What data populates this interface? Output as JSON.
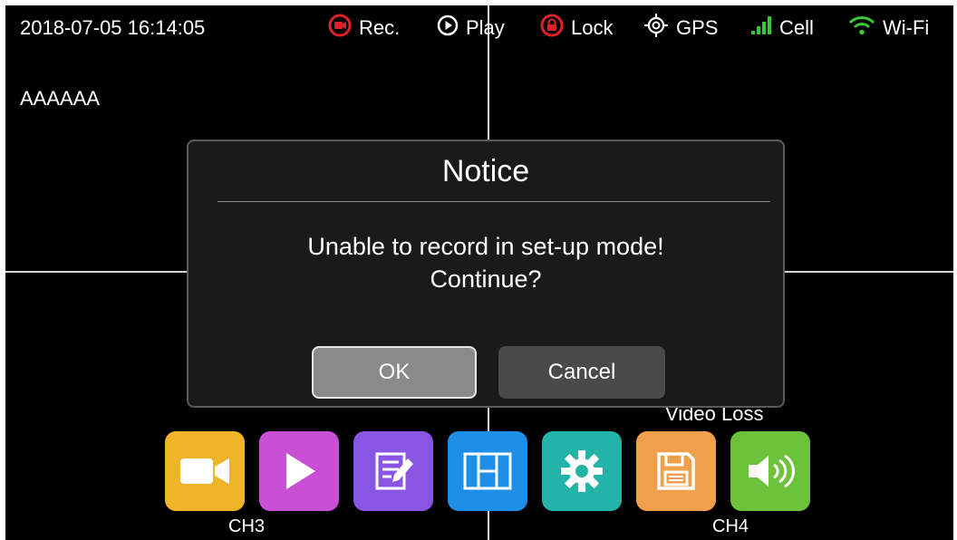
{
  "status_bar": {
    "datetime": "2018-07-05 16:14:05",
    "items": [
      {
        "label": "Rec.",
        "icon": "record-icon",
        "color": "#e0202a"
      },
      {
        "label": "Play",
        "icon": "play-circle-icon",
        "color": "#ffffff"
      },
      {
        "label": "Lock",
        "icon": "lock-icon",
        "color": "#e0202a"
      },
      {
        "label": "GPS",
        "icon": "gps-target-icon",
        "color": "#ffffff"
      },
      {
        "label": "Cell",
        "icon": "signal-bars-icon",
        "color": "#37c837"
      },
      {
        "label": "Wi-Fi",
        "icon": "wifi-icon",
        "color": "#37c837"
      }
    ]
  },
  "channels": {
    "ch1_label": "AAAAAA",
    "ch3_label": "CH3",
    "ch4_label": "CH4",
    "video_loss": "Video Loss"
  },
  "dialog": {
    "title": "Notice",
    "message_line1": "Unable to record in set-up mode!",
    "message_line2": "Continue?",
    "ok_label": "OK",
    "cancel_label": "Cancel"
  },
  "toolbar": [
    {
      "icon": "camera-icon",
      "color": "#f0b429"
    },
    {
      "icon": "play-icon",
      "color": "#c94fd6"
    },
    {
      "icon": "edit-note-icon",
      "color": "#8a55e0"
    },
    {
      "icon": "layout-grid-icon",
      "color": "#1e8fe8"
    },
    {
      "icon": "settings-gear-icon",
      "color": "#24b3a8"
    },
    {
      "icon": "save-disk-icon",
      "color": "#f0a04a"
    },
    {
      "icon": "volume-icon",
      "color": "#6cc23a"
    }
  ]
}
